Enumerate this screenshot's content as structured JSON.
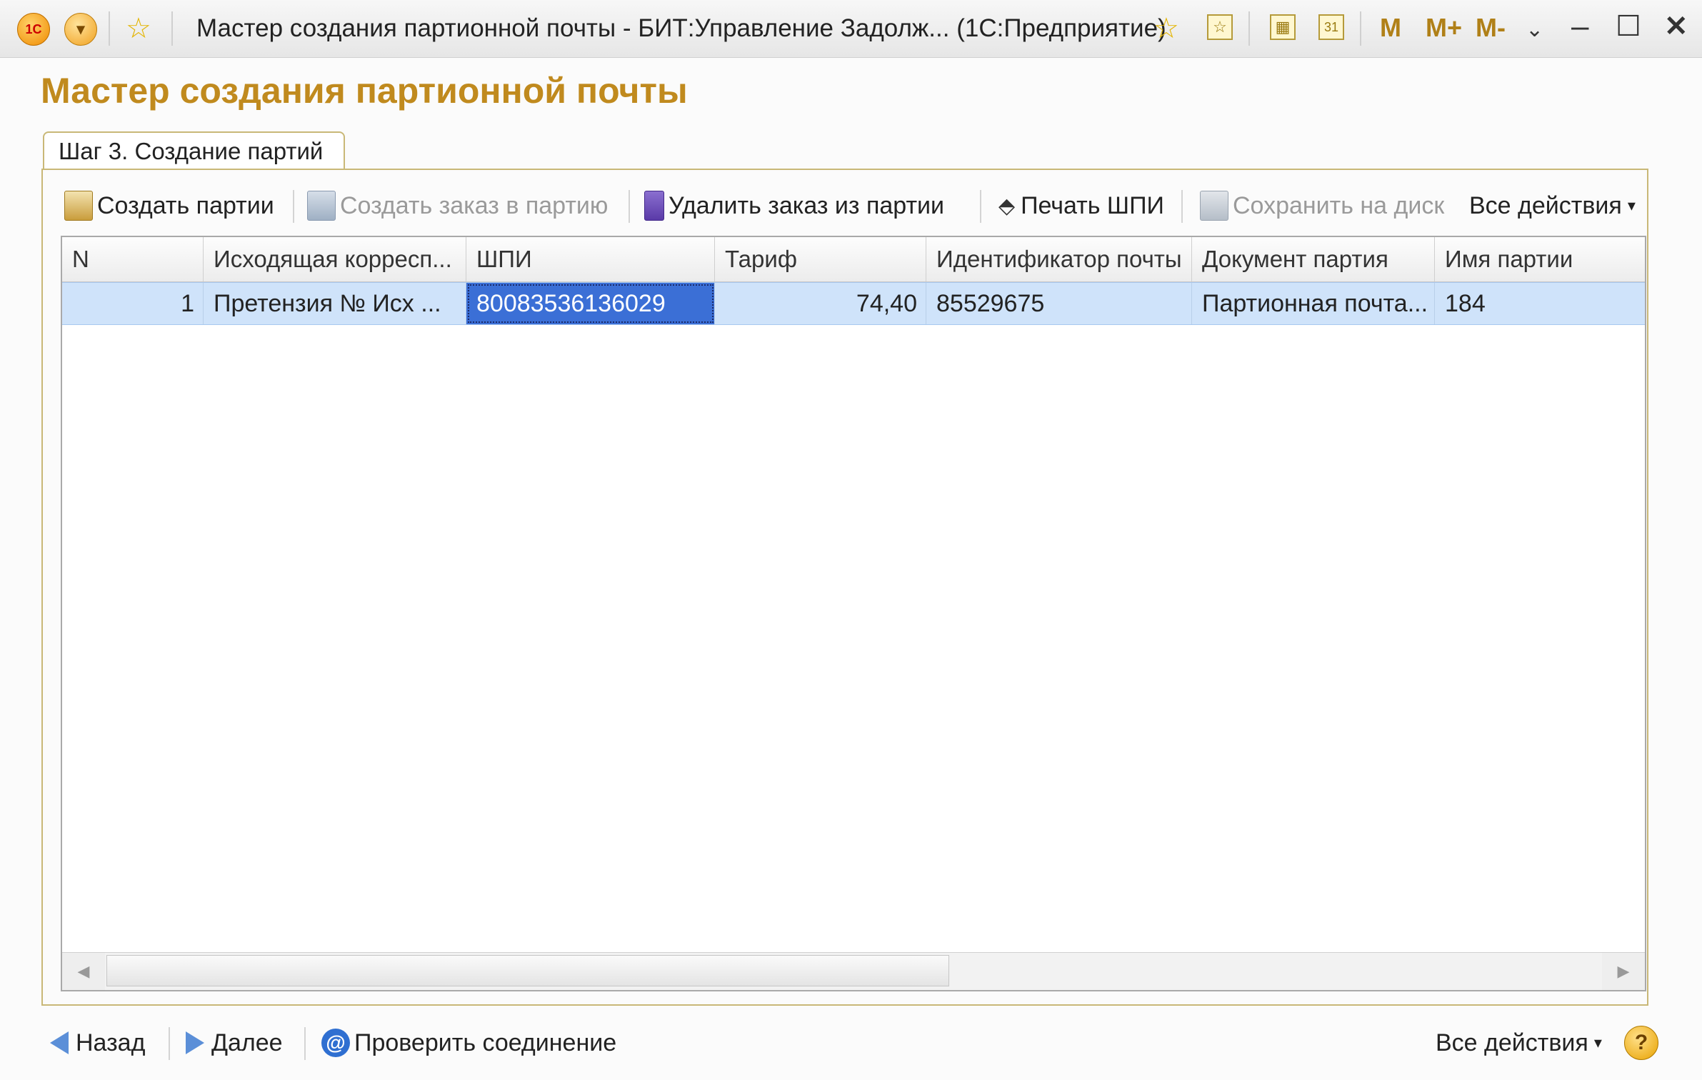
{
  "window": {
    "title": "Мастер создания партионной почты - БИТ:Управление Задолж... (1С:Предприятие)",
    "memory_buttons": [
      "M",
      "M+",
      "M-"
    ]
  },
  "page": {
    "title": "Мастер создания партионной почты",
    "tab_label": "Шаг 3. Создание партий"
  },
  "toolbar": {
    "create_batches": "Создать партии",
    "create_order_in_batch": "Создать заказ в партию",
    "delete_order_from_batch": "Удалить заказ из партии",
    "print_shpi": "Печать ШПИ",
    "save_to_disk": "Сохранить на диск",
    "all_actions": "Все действия"
  },
  "table": {
    "columns": [
      "N",
      "Исходящая корресп...",
      "ШПИ",
      "Тариф",
      "Идентификатор почты",
      "Документ партия",
      "Имя партии"
    ],
    "rows": [
      {
        "n": "1",
        "outgoing": "Претензия № Исх ...",
        "shpi": "80083536136029",
        "tariff": "74,40",
        "mail_id": "85529675",
        "batch_doc": "Партионная почта...",
        "batch_name": "184"
      }
    ]
  },
  "footer": {
    "back": "Назад",
    "next": "Далее",
    "check_connection": "Проверить соединение",
    "all_actions": "Все действия",
    "help": "?"
  }
}
